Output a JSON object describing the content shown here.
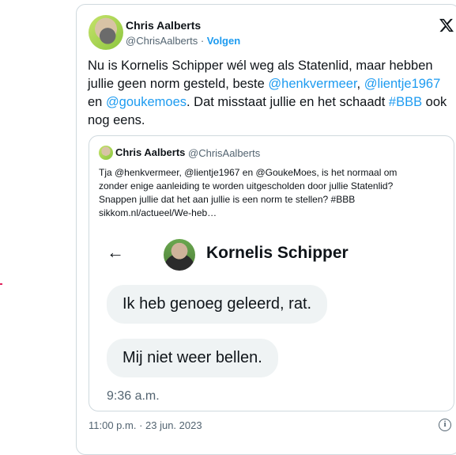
{
  "tweet": {
    "author_name": "Chris Aalberts",
    "author_handle": "@ChrisAalberts",
    "separator": " · ",
    "follow_label": "Volgen",
    "text_parts": {
      "p1": "Nu is Kornelis Schipper wél weg als Statenlid, maar hebben jullie geen norm gesteld, beste ",
      "m1": "@henkvermeer",
      "p2": ", ",
      "m2": "@lientje1967",
      "p3": " en ",
      "m3": "@goukemoes",
      "p4": ". Dat misstaat jullie en het schaadt ",
      "m4": "#BBB",
      "p5": " ook nog eens."
    },
    "timestamp": "11:00 p.m. · 23 jun. 2023",
    "info_glyph": "i"
  },
  "quote": {
    "author_name": "Chris Aalberts",
    "author_handle": "@ChrisAalberts",
    "text_line1": "Tja @henkvermeer, @lientje1967 en @GoukeMoes, is het normaal om",
    "text_line2": "zonder enige aanleiding te worden uitgescholden door jullie Statenlid?",
    "text_line3": "Snappen jullie dat het aan jullie is een norm te stellen? #BBB",
    "text_line4": "sikkom.nl/actueel/We-heb…"
  },
  "screenshot": {
    "back_glyph": "←",
    "contact_name": "Kornelis Schipper",
    "messages": [
      "Ik heb genoeg geleerd, rat.",
      "Mij niet weer bellen."
    ],
    "time": "9:36 a.m."
  },
  "icons": {
    "x_logo": "x-logo-icon",
    "back": "back-arrow-icon",
    "info": "info-icon"
  },
  "colors": {
    "accent": "#1d9bf0",
    "text": "#0f1419",
    "muted": "#536471",
    "border": "#cfd9de",
    "bubble": "#eff3f4"
  }
}
